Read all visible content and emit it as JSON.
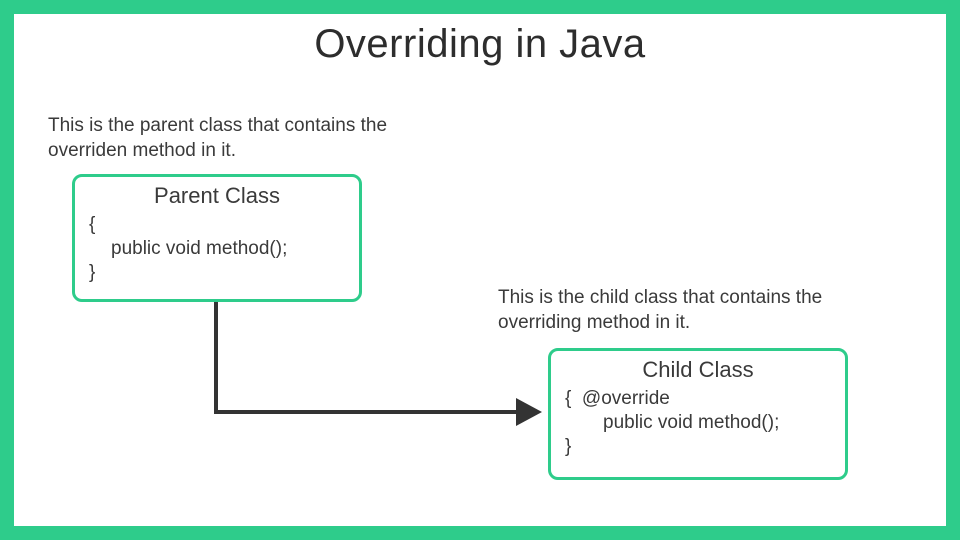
{
  "title": "Overriding in Java",
  "colors": {
    "accent": "#2ECC8B",
    "text": "#3a3a3a",
    "arrow": "#333333"
  },
  "parent": {
    "caption": "This is the parent class that contains the overriden method in it.",
    "box_title": "Parent Class",
    "brace_open": "{",
    "line1": "public void method();",
    "brace_close": "}"
  },
  "child": {
    "caption": "This is the child class that contains the overriding method in it.",
    "box_title": "Child Class",
    "brace_open": "{",
    "line1": "@override",
    "line2": "public void method();",
    "brace_close": "}"
  }
}
